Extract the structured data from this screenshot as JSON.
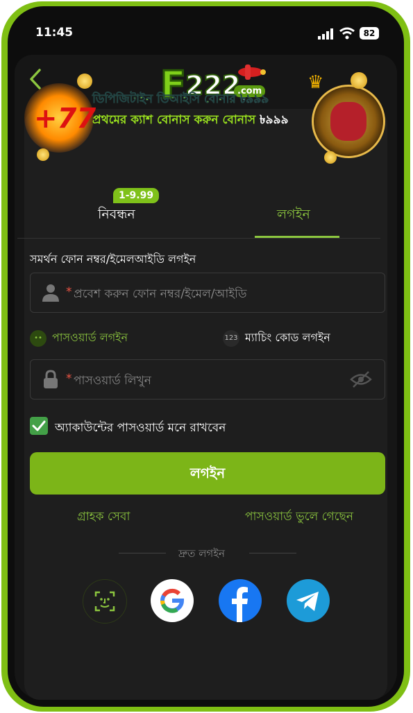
{
  "status_bar": {
    "time": "11:45",
    "battery": "82"
  },
  "header": {
    "logo_main": "F",
    "logo_digits": "222",
    "logo_suffix": ".com"
  },
  "banner": {
    "line1_text": "ডিপিজিটাইন ডিআইসি বোনার ",
    "line1_amount": "৳৯৯৯",
    "line2_text": "প্রথমের ক্যাশ বোনাস করুন বোনাস ",
    "line2_amount": "৳৯৯৯",
    "seven_text": "+77"
  },
  "tabs": {
    "register_label": "নিবন্ধন",
    "register_badge": "1-9.99",
    "login_label": "লগইন",
    "active": "login"
  },
  "form": {
    "section_label": "সমর্থন ফোন নম্বর/ইমেলআইডি লগইন",
    "account_required_mark": "*",
    "account_placeholder": "প্রবেশ করুন ফোন নম্বর/ইমেল/আইডি",
    "password_mode_label": "পাসওয়ার্ড লগইন",
    "code_mode_icon_text": "123",
    "code_mode_label": "ম্যাচিং কোড লগইন",
    "password_required_mark": "*",
    "password_placeholder": "পাসওয়ার্ড লিখুন",
    "remember_label": "অ্যাকাউন্টের পাসওয়ার্ড মনে রাখবেন",
    "remember_checked": true,
    "login_button": "লগইন"
  },
  "links": {
    "support": "গ্রাহক সেবা",
    "forgot": "পাসওয়ার্ড ভুলে গেছেন"
  },
  "quick_login": {
    "label": "দ্রুত লগইন",
    "providers": [
      "face-id",
      "google",
      "facebook",
      "telegram"
    ]
  },
  "colors": {
    "accent": "#8cc63f",
    "button": "#7cb518",
    "frame": "#7fbf14",
    "background": "#161616"
  }
}
